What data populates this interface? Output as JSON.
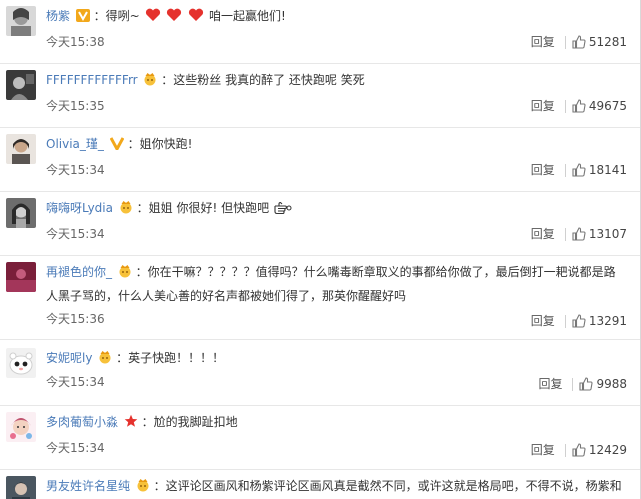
{
  "comments": [
    {
      "user": "杨紫",
      "badge": "gold-v",
      "text_before": "：得咧~",
      "text_after": "咱一起赢他们!",
      "time": "今天15:38",
      "reply_label": "回复",
      "likes": "51281"
    },
    {
      "user": "FFFFFFFFFFFFrr",
      "badge": "crown-emoji",
      "text": "：这些粉丝 我真的醉了 还快跑呢 笑死",
      "time": "今天15:35",
      "reply_label": "回复",
      "likes": "49675"
    },
    {
      "user": "Olivia_瑾_",
      "badge": "gold-v",
      "text": "：姐你快跑!",
      "time": "今天15:34",
      "reply_label": "回复",
      "likes": "18141"
    },
    {
      "user": "嗨嗨呀Lydia",
      "badge": "crown-emoji",
      "text": "：姐姐 你很好! 但快跑吧",
      "time": "今天15:34",
      "reply_label": "回复",
      "likes": "13107"
    },
    {
      "user": "再褪色的你_",
      "badge": "crown-emoji",
      "text": "：你在干嘛？？？？？值得吗？什么嘴毒断章取义的事都给你做了，最后倒打一耙说都是路",
      "text_line2": "人黑子骂的，什么人美心善的好名声都被她们得了，那英你醒醒好吗",
      "time": "今天15:36",
      "reply_label": "回复",
      "likes": "13291"
    },
    {
      "user": "安妮呢ly",
      "badge": "crown-emoji",
      "text": "：英子快跑！！！！",
      "time": "今天15:34",
      "reply_label": "回复",
      "likes": "9988"
    },
    {
      "user": "多肉葡萄小淼",
      "badge": "red-star",
      "text": "：尬的我脚趾扣地",
      "time": "今天15:34",
      "reply_label": "回复",
      "likes": "12429"
    },
    {
      "user": "男友姓许名星纯",
      "badge": "crown-emoji",
      "text": "：这评论区画风和杨紫评论区画风真是截然不同，或许这就是格局吧，不得不说，杨紫和"
    }
  ],
  "colors": {
    "username": "#4b7bb8",
    "text": "#333333",
    "meta": "#666666",
    "divider": "#e7e7e7",
    "heart": "#e5322d",
    "gold": "#f2a81b"
  }
}
